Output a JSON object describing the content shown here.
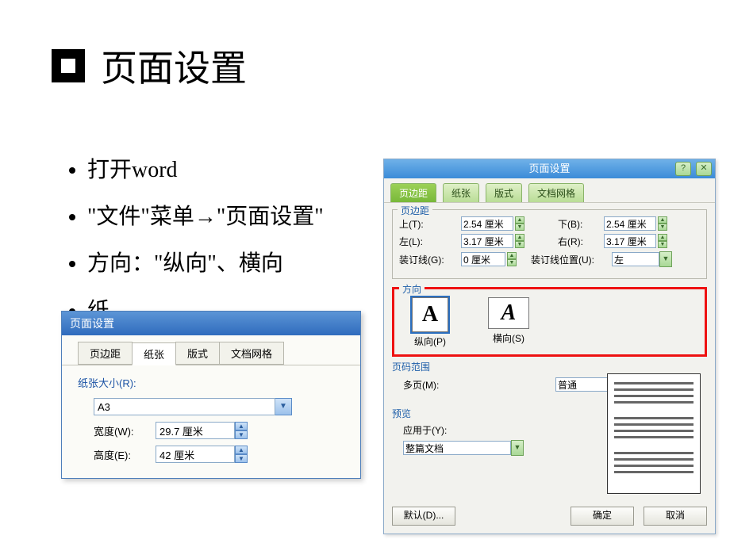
{
  "slide": {
    "title": "页面设置",
    "bullets": [
      "打开word",
      "\"文件\"菜单→\"页面设置\"",
      "方向：\"纵向\"、横向",
      "纸"
    ]
  },
  "right_dialog": {
    "title": "页面设置",
    "help_btn": "?",
    "close_btn": "✕",
    "tabs": {
      "margins": "页边距",
      "paper": "纸张",
      "layout": "版式",
      "grid": "文档网格"
    },
    "margins_group": "页边距",
    "top_l": "上(T):",
    "top_v": "2.54 厘米",
    "bot_l": "下(B):",
    "bot_v": "2.54 厘米",
    "left_l": "左(L):",
    "left_v": "3.17 厘米",
    "right_l": "右(R):",
    "right_v": "3.17 厘米",
    "gutter_l": "装订线(G):",
    "gutter_v": "0 厘米",
    "gutterpos_l": "装订线位置(U):",
    "gutterpos_v": "左",
    "orient_group": "方向",
    "portrait": "纵向(P)",
    "landscape": "横向(S)",
    "range_group": "页码范围",
    "multi_l": "多页(M):",
    "multi_v": "普通",
    "preview_group": "预览",
    "apply_l": "应用于(Y):",
    "apply_v": "整篇文档",
    "default_btn": "默认(D)...",
    "ok_btn": "确定",
    "cancel_btn": "取消"
  },
  "left_dialog": {
    "title": "页面设置",
    "tabs": {
      "margins": "页边距",
      "paper": "纸张",
      "layout": "版式",
      "grid": "文档网格"
    },
    "size_group": "纸张大小(R):",
    "size_v": "A3",
    "width_l": "宽度(W):",
    "width_v": "29.7 厘米",
    "height_l": "高度(E):",
    "height_v": "42 厘米"
  }
}
